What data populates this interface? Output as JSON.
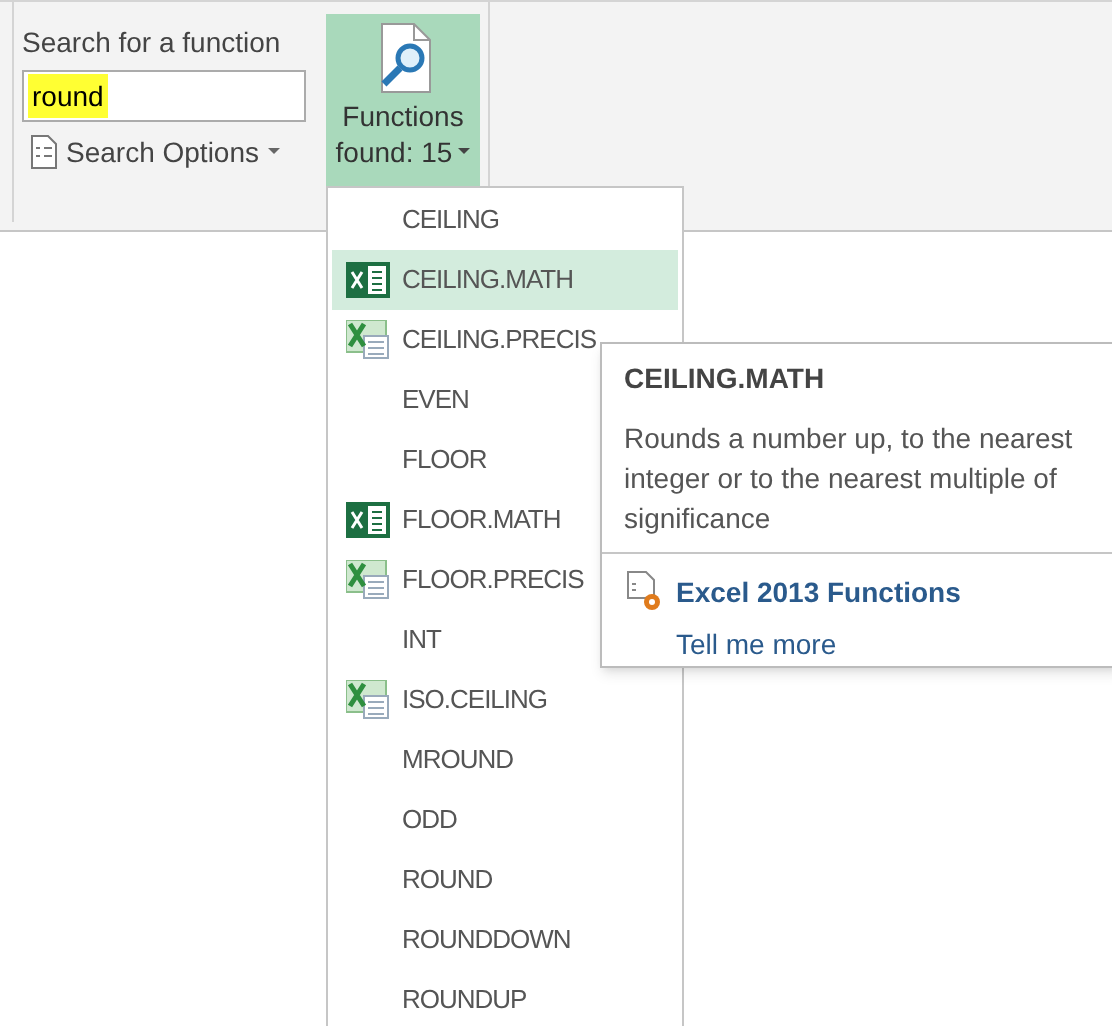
{
  "search": {
    "label": "Search for a function",
    "value": "round",
    "options_button": "Search Options"
  },
  "functions_button": {
    "line1": "Functions",
    "line2": "found: 15",
    "expanded": true
  },
  "functions": [
    {
      "name": "CEILING",
      "kind": "none",
      "selected": false
    },
    {
      "name": "CEILING.MATH",
      "kind": "new",
      "selected": true
    },
    {
      "name": "CEILING.PRECIS",
      "kind": "compat",
      "selected": false
    },
    {
      "name": "EVEN",
      "kind": "none",
      "selected": false
    },
    {
      "name": "FLOOR",
      "kind": "none",
      "selected": false
    },
    {
      "name": "FLOOR.MATH",
      "kind": "new",
      "selected": false
    },
    {
      "name": "FLOOR.PRECIS",
      "kind": "compat",
      "selected": false
    },
    {
      "name": "INT",
      "kind": "none",
      "selected": false
    },
    {
      "name": "ISO.CEILING",
      "kind": "compat",
      "selected": false
    },
    {
      "name": "MROUND",
      "kind": "none",
      "selected": false
    },
    {
      "name": "ODD",
      "kind": "none",
      "selected": false
    },
    {
      "name": "ROUND",
      "kind": "none",
      "selected": false
    },
    {
      "name": "ROUNDDOWN",
      "kind": "none",
      "selected": false
    },
    {
      "name": "ROUNDUP",
      "kind": "none",
      "selected": false
    }
  ],
  "tooltip": {
    "title": "CEILING.MATH",
    "description": "Rounds a number up, to the nearest integer or to the nearest multiple of significance",
    "link": "Excel 2013 Functions",
    "more": "Tell me more"
  }
}
